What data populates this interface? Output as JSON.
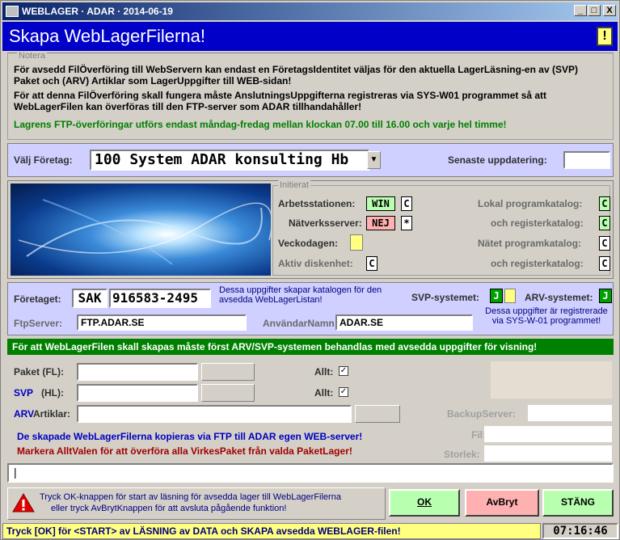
{
  "window": {
    "title": "WEBLAGER · ADAR · 2014-06-19",
    "header": "Skapa WebLagerFilerna!",
    "minimize": "_",
    "maximize": "□",
    "close": "X",
    "alert_glyph": "!"
  },
  "notera": {
    "legend": "Notera",
    "line1": "För avsedd FilÖverföring till WebServern kan endast en FöretagsIdentitet väljas för den aktuella LagerLäsning-en av (SVP) Paket och (ARV) Artiklar som LagerUppgifter till WEB-sidan!",
    "line2": "För att denna FilÖverföring skall fungera måste AnslutningsUppgifterna registreras via SYS-W01 programmet så att WebLagerFilen kan överföras till den FTP-server som ADAR tillhandahåller!",
    "line3": "Lagrens FTP-överföringar utförs endast måndag-fredag mellan klockan 07.00 till 16.00 och varje hel timme!"
  },
  "company": {
    "label": "Välj Företag:",
    "value": "100 System ADAR konsulting Hb",
    "last_update_label": "Senaste uppdatering:",
    "last_update_value": ""
  },
  "initierat": {
    "legend": "Initierat",
    "arbetsstation_label": "Arbetsstationen:",
    "arbetsstation_value": "WIN",
    "arbetsstation_drive": "C",
    "natverk_label": "Nätverksserver:",
    "natverk_value": "NEJ",
    "natverk_drive": "*",
    "veckodag_label": "Veckodagen:",
    "aktiv_label": "Aktiv diskenhet:",
    "aktiv_value": "C",
    "lokal_prog_label": "Lokal programkatalog:",
    "lokal_prog_value": "C",
    "lokal_reg_label": "och registerkatalog:",
    "lokal_reg_value": "C",
    "nat_prog_label": "Nätet programkatalog:",
    "nat_prog_value": "C",
    "nat_reg_label": "och registerkatalog:",
    "nat_reg_value": "C"
  },
  "company_info": {
    "foretaget_label": "Företaget:",
    "code": "SAK",
    "orgnr": "916583-2495",
    "note1": "Dessa uppgifter skapar katalogen för den avsedda WebLagerListan!",
    "svp_label": "SVP-systemet:",
    "svp_value": "J",
    "arv_label": "ARV-systemet:",
    "arv_value": "J",
    "ftp_label": "FtpServer:",
    "ftp_value": "FTP.ADAR.SE",
    "user_label": "AnvändarNamn:",
    "user_value": "ADAR.SE",
    "note2": "Dessa uppgifter är registrerade via SYS-W-01 programmet!"
  },
  "green_bar": "För att WebLagerFilen skall skapas måste först ARV/SVP-systemen behandlas med avsedda uppgifter för visning!",
  "form": {
    "paket_label": "Paket (FL):",
    "svp_label": "SVP",
    "hl_label": "(HL):",
    "allt_label": "Allt:",
    "arv_label": "ARV",
    "artiklar_label": "Artiklar:",
    "backup_label": "BackupServer:",
    "fil_label": "Fil:",
    "storlek_label": "Storlek:",
    "check": "✓"
  },
  "info": {
    "blue": "De skapade WebLagerFilerna kopieras via FTP till ADAR egen WEB-server!",
    "red": "Markera AlltValen för att överföra alla VirkesPaket från valda PaketLager!"
  },
  "progress_text": "|",
  "warning": {
    "line1": "Tryck OK-knappen för start av läsning för avsedda lager till WebLagerFilerna",
    "line2": "eller tryck AvBrytKnappen för att avsluta pågående funktion!"
  },
  "buttons": {
    "ok": "OK",
    "avbryt": "AvBryt",
    "stang": "STÄNG"
  },
  "status": {
    "text": "Tryck [OK] för <START> av LÄSNING av DATA och SKAPA avsedda WEBLAGER-filen!",
    "clock": "07:16:46"
  },
  "colors": {
    "title_blue": "#0000c8",
    "green": "#008000",
    "lavender": "#cfd0ff",
    "yellow": "#ffff80",
    "pink": "#ffb0b0",
    "light_green": "#b8ffb0"
  }
}
